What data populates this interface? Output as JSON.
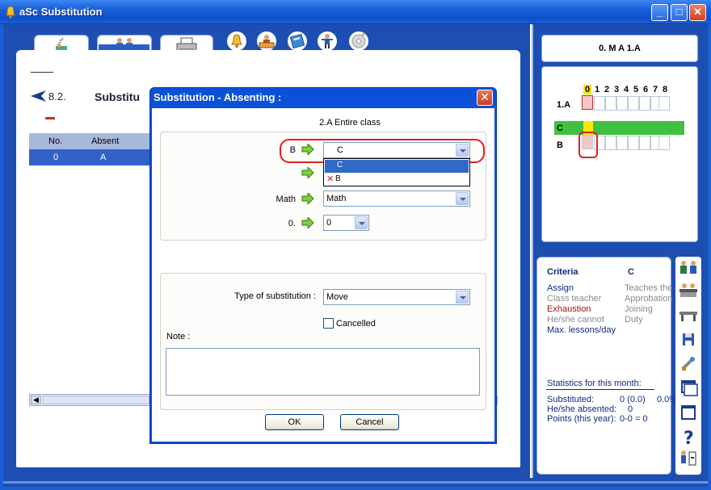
{
  "window": {
    "title": "aSc Substitution",
    "min_label": "_",
    "max_label": "□",
    "close_label": "✕"
  },
  "main": {
    "back_label": "8.2.",
    "heading": "Substitu",
    "table": {
      "headers": [
        "No.",
        "Absent"
      ],
      "rows": [
        [
          "0",
          "A"
        ]
      ]
    }
  },
  "right_panel": {
    "lesson_header": "0. M A 1.A",
    "grid": {
      "periods": [
        "0",
        "1",
        "2",
        "3",
        "4",
        "5",
        "6",
        "7",
        "8"
      ],
      "highlighted_period": "0",
      "rows": [
        "1.A",
        "C",
        "B"
      ]
    },
    "criteria": {
      "title": "Criteria",
      "teacher": "C",
      "left_items": [
        "Assign",
        "Class teacher",
        "Exhaustion",
        "He/she cannot",
        "Max. lessons/day"
      ],
      "right_items": [
        "Teaches the",
        "Approbation",
        "Joining",
        "Duty"
      ],
      "stats_title": "Statistics for this month:",
      "stats": [
        {
          "label": "Substituted:",
          "value": "0 (0.0)",
          "extra": "0.0%"
        },
        {
          "label": "He/she absented:",
          "value": "0"
        },
        {
          "label": "Points (this year):",
          "value": "0-0 = 0"
        }
      ]
    }
  },
  "dialog": {
    "title": "Substitution - Absenting :",
    "close_label": "✕",
    "heading": "2.A Entire class",
    "teacher_label": "B",
    "teacher_value": "C",
    "dropdown_options": [
      {
        "label": "C",
        "selected": true
      },
      {
        "label": "B",
        "mark": "✕"
      }
    ],
    "subject_label": "Math",
    "subject_value": "Math",
    "period_label": "0.",
    "period_value": "0",
    "type_label": "Type of substitution :",
    "type_value": "Move",
    "cancelled_label": "Cancelled",
    "cancelled_checked": false,
    "note_label": "Note :",
    "note_value": "",
    "ok_label": "OK",
    "cancel_label": "Cancel"
  },
  "colors": {
    "title_bar": "#1a5fd6",
    "main_bg": "#1d4fb2",
    "selected_row": "#3262c8",
    "green_bar": "#40c040",
    "highlight_yellow": "#ffe600",
    "annotation_red": "#e02020"
  },
  "icons": [
    "app-bell-icon",
    "teachers-tab-icon",
    "classes-tab-icon",
    "printer-tab-icon",
    "bell-icon",
    "teacher-desk-icon",
    "book-icon",
    "person-icon",
    "cd-icon",
    "back-arrow-icon",
    "green-arrow-icon",
    "save-icon",
    "tools-icon",
    "window-icon",
    "help-icon"
  ]
}
